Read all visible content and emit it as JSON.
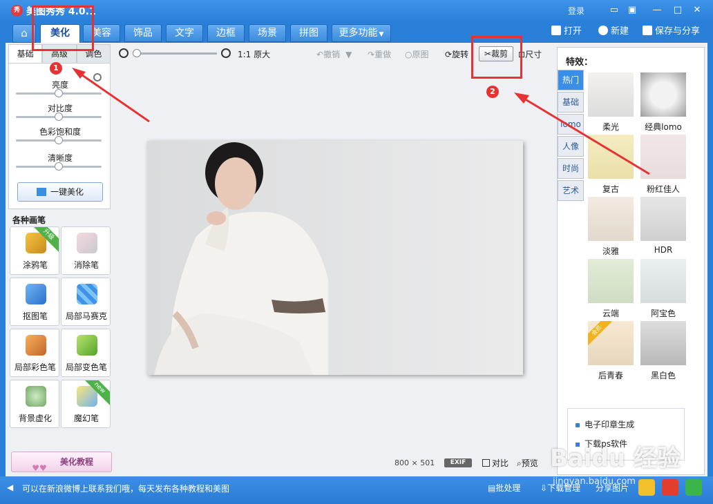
{
  "app": {
    "title": "美图秀秀 4.0.1",
    "icon_text": "秀"
  },
  "titlebar": {
    "login": "登录"
  },
  "nav": {
    "tabs": [
      {
        "label": "美化",
        "active": true
      },
      {
        "label": "美容"
      },
      {
        "label": "饰品"
      },
      {
        "label": "文字"
      },
      {
        "label": "边框"
      },
      {
        "label": "场景"
      },
      {
        "label": "拼图"
      },
      {
        "label": "更多功能"
      }
    ],
    "open": "打开",
    "new": "新建",
    "save_share": "保存与分享"
  },
  "left": {
    "subtabs": [
      "基础",
      "高级",
      "调色"
    ],
    "sliders": [
      {
        "label": "亮度",
        "value": 0.5
      },
      {
        "label": "对比度",
        "value": 0.5
      },
      {
        "label": "色彩饱和度",
        "value": 0.5
      },
      {
        "label": "清晰度",
        "value": 0.5
      }
    ],
    "one_key": "一键美化",
    "brush_title": "各种画笔",
    "brushes": [
      {
        "label": "涂鸦笔",
        "badge": "升级"
      },
      {
        "label": "消除笔"
      },
      {
        "label": "抠图笔"
      },
      {
        "label": "局部马赛克"
      },
      {
        "label": "局部彩色笔"
      },
      {
        "label": "局部变色笔"
      },
      {
        "label": "背景虚化"
      },
      {
        "label": "魔幻笔",
        "badge": "new"
      }
    ],
    "tutorial": "美化教程"
  },
  "toolbar": {
    "zoom_level": 0.0,
    "original_size": "1:1 原大",
    "undo": "撤销",
    "redo": "重做",
    "original": "原图",
    "rotate": "旋转",
    "crop": "裁剪",
    "resize": "尺寸"
  },
  "canvas": {
    "dims": "800 × 501",
    "exif": "EXIF",
    "compare": "对比",
    "preview": "预览"
  },
  "effects": {
    "title": "特效：",
    "categories": [
      "热门",
      "基础",
      "lomo",
      "人像",
      "时尚",
      "艺术"
    ],
    "items": [
      {
        "label": "柔光"
      },
      {
        "label": "经典lomo"
      },
      {
        "label": "复古"
      },
      {
        "label": "粉红佳人"
      },
      {
        "label": "淡雅"
      },
      {
        "label": "HDR"
      },
      {
        "label": "云端"
      },
      {
        "label": "阿宝色"
      },
      {
        "label": "后青春",
        "badge": "会员"
      },
      {
        "label": "黑白色"
      }
    ],
    "promo": [
      "电子印章生成",
      "下载ps软件"
    ]
  },
  "status": {
    "message": "可以在新浪微博上联系我们哦，每天发布各种教程和美图",
    "batch": "批处理",
    "download": "下载管理",
    "share_pic": "分享图片"
  },
  "annotations": [
    "1",
    "2"
  ],
  "watermark": {
    "main": "Baidu 经验",
    "url": "jingyan.baidu.com"
  }
}
